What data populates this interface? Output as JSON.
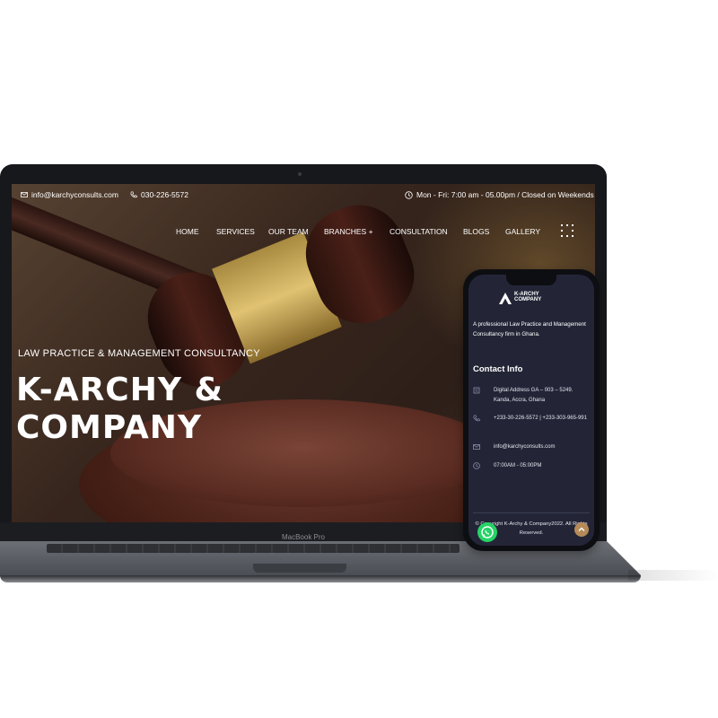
{
  "top_bar": {
    "email": "info@karchyconsults.com",
    "phone": "030-226-5572",
    "hours": "Mon - Fri: 7:00 am - 05.00pm / Closed on Weekends"
  },
  "nav": {
    "items": [
      "HOME",
      "SERVICES",
      "OUR TEAM",
      "BRANCHES +",
      "CONSULTATION",
      "BLOGS",
      "GALLERY"
    ]
  },
  "hero": {
    "tagline": "LAW PRACTICE & MANAGEMENT CONSULTANCY",
    "title_line1": "K-ARCHY &",
    "title_line2": "COMPANY"
  },
  "laptop": {
    "label": "MacBook Pro"
  },
  "phone": {
    "logo_line1": "K-ARCHY",
    "logo_line2": "COMPANY",
    "description": "A professional Law Practice and Management Consultancy firm in Ghana.",
    "contact_heading": "Contact Info",
    "address": "Digital Address GA – 003 – 5249. Kanda, Accra, Ghana",
    "phones": "+233-30-226-5572 | +233-303-965-991",
    "email": "info@karchyconsults.com",
    "hours": "07:00AM - 05:00PM",
    "copyright": "© Copyright K-Archy & Company2022. All Rights Reserved."
  },
  "colors": {
    "footer_bg": "#232537",
    "accent_gold": "#b58a58",
    "whatsapp_green": "#25d366"
  },
  "icons": [
    "mail-icon",
    "phone-icon",
    "clock-icon",
    "grid-menu-icon",
    "location-icon",
    "whatsapp-icon",
    "chevron-up-icon"
  ]
}
